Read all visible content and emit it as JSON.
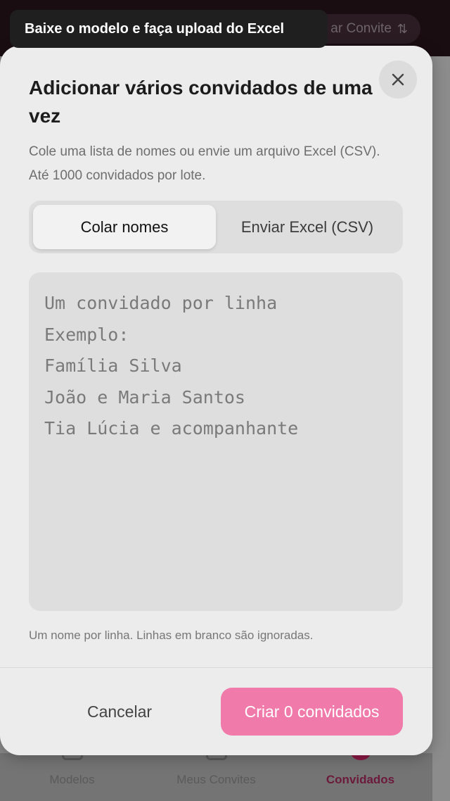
{
  "background": {
    "header_pill_label": "ar Convite",
    "sort_icon": "sort-icon",
    "nav": [
      {
        "label": "Modelos",
        "active": false
      },
      {
        "label": "Meus Convites",
        "active": false
      },
      {
        "label": "Convidados",
        "active": true
      }
    ]
  },
  "tooltip": {
    "text": "Baixe o modelo e faça upload do Excel"
  },
  "modal": {
    "title": "Adicionar vários convidados de uma vez",
    "description": "Cole uma lista de nomes ou envie um arquivo Excel (CSV). Até 1000 convidados por lote.",
    "tabs": [
      {
        "label": "Colar nomes",
        "active": true
      },
      {
        "label": "Enviar Excel (CSV)",
        "active": false
      }
    ],
    "textarea_placeholder": "Um convidado por linha\nExemplo:\nFamília Silva\nJoão e Maria Santos\nTia Lúcia e acompanhante",
    "textarea_value": "",
    "hint": "Um nome por linha. Linhas em branco são ignoradas.",
    "cancel_label": "Cancelar",
    "create_label": "Criar 0 convidados",
    "close_icon": "close-icon"
  },
  "colors": {
    "primary_button": "#f07aaa",
    "active_nav": "#6b1a3a"
  }
}
